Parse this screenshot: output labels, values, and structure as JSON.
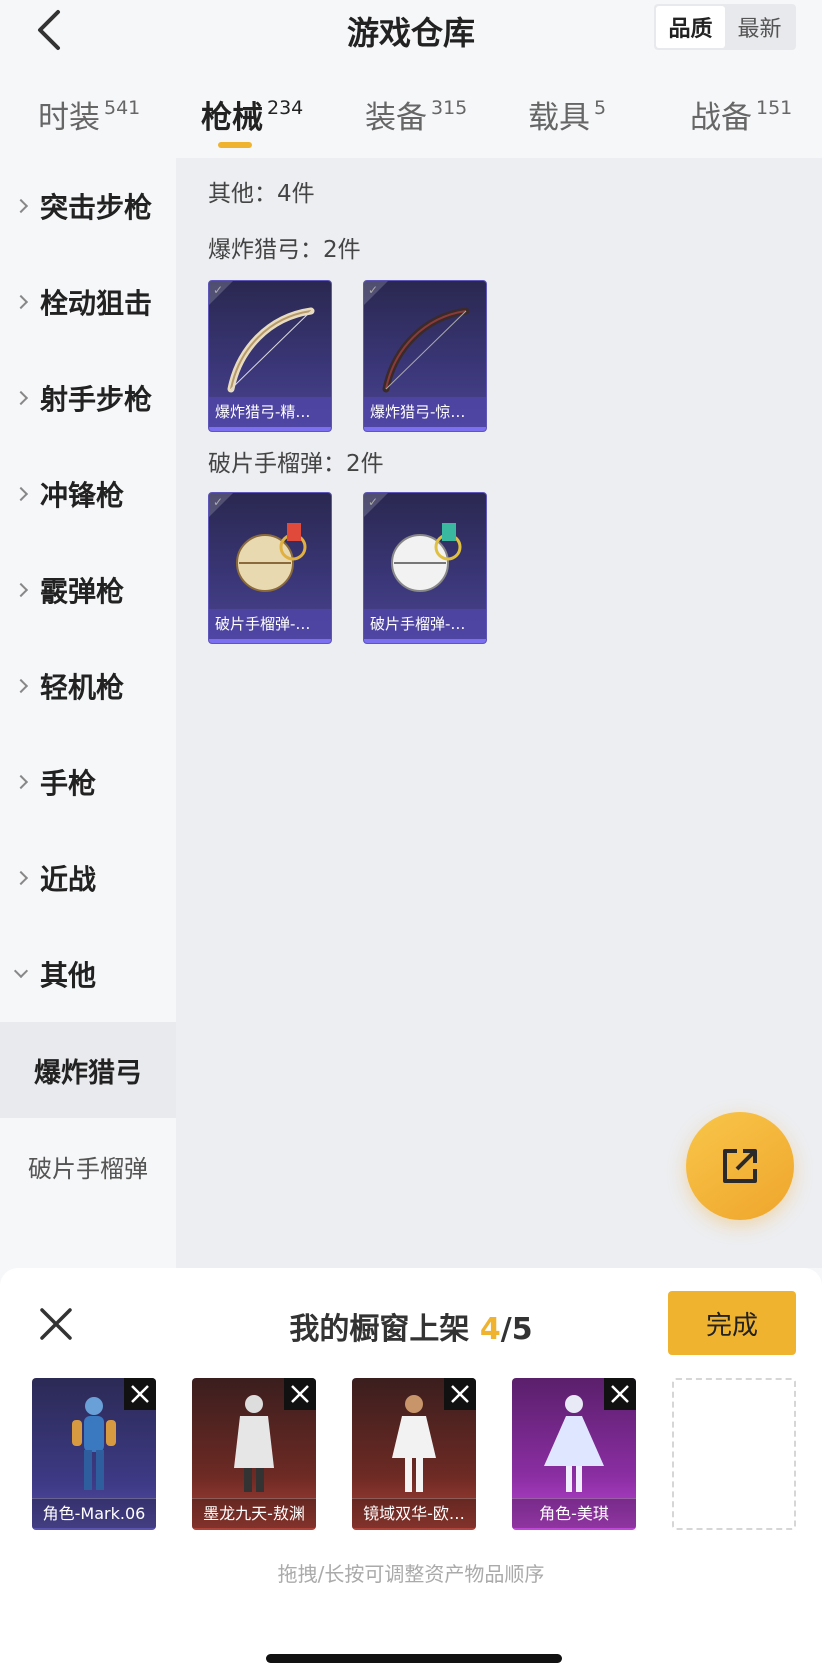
{
  "header": {
    "title": "游戏仓库",
    "sort_options": [
      "品质",
      "最新"
    ]
  },
  "tabs": [
    {
      "label": "时装",
      "count": "541"
    },
    {
      "label": "枪械",
      "count": "234"
    },
    {
      "label": "装备",
      "count": "315"
    },
    {
      "label": "载具",
      "count": "5"
    },
    {
      "label": "战备",
      "count": "151"
    }
  ],
  "sidebar": {
    "categories": [
      "突击步枪",
      "栓动狙击",
      "射手步枪",
      "冲锋枪",
      "霰弹枪",
      "轻机枪",
      "手枪",
      "近战",
      "其他"
    ],
    "sub_items": [
      "爆炸猎弓",
      "破片手榴弹"
    ]
  },
  "main": {
    "summary": "其他：4件",
    "groups": [
      {
        "title": "爆炸猎弓：2件",
        "items": [
          "爆炸猎弓-精…",
          "爆炸猎弓-惊…"
        ]
      },
      {
        "title": "破片手榴弹：2件",
        "items": [
          "破片手榴弹-…",
          "破片手榴弹-…"
        ]
      }
    ]
  },
  "sheet": {
    "title_prefix": "我的橱窗上架 ",
    "count": "4",
    "total": "/5",
    "done_label": "完成",
    "shelf_items": [
      {
        "label": "角色-Mark.06",
        "tone": "blue"
      },
      {
        "label": "墨龙九天-敖渊",
        "tone": "red"
      },
      {
        "label": "镜域双华-欧…",
        "tone": "red"
      },
      {
        "label": "角色-美琪",
        "tone": "purple"
      }
    ],
    "hint": "拖拽/长按可调整资产物品顺序"
  },
  "colors": {
    "accent": "#f0b330",
    "card_blue": "#3b377a"
  }
}
